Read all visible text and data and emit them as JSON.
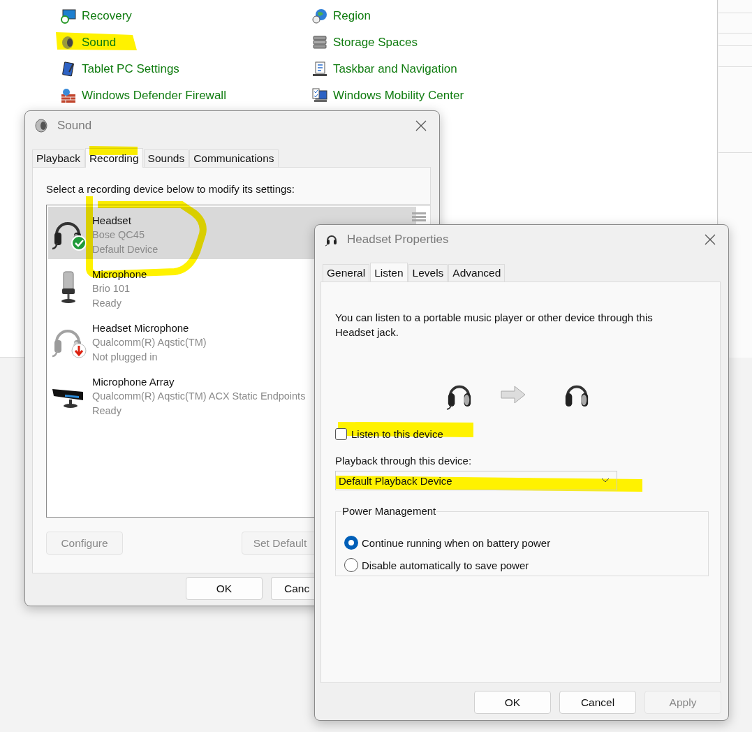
{
  "control_panel": {
    "columns": [
      [
        {
          "label": "Recovery"
        },
        {
          "label": "Sound"
        },
        {
          "label": "Tablet PC Settings"
        },
        {
          "label": "Windows Defender Firewall"
        }
      ],
      [
        {
          "label": "Region"
        },
        {
          "label": "Storage Spaces"
        },
        {
          "label": "Taskbar and Navigation"
        },
        {
          "label": "Windows Mobility Center"
        }
      ]
    ]
  },
  "sound_dialog": {
    "title": "Sound",
    "tabs": [
      {
        "label": "Playback",
        "selected": false
      },
      {
        "label": "Recording",
        "selected": true
      },
      {
        "label": "Sounds",
        "selected": false
      },
      {
        "label": "Communications",
        "selected": false
      }
    ],
    "instruction": "Select a recording device below to modify its settings:",
    "devices": [
      {
        "kind": "headset",
        "name": "Headset",
        "model": "Bose QC45",
        "status": "Default Device",
        "default": true,
        "unplugged": false,
        "selected": true
      },
      {
        "kind": "microphone",
        "name": "Microphone",
        "model": "Brio 101",
        "status": "Ready",
        "default": false,
        "unplugged": false,
        "selected": false
      },
      {
        "kind": "headset",
        "name": "Headset Microphone",
        "model": "Qualcomm(R) Aqstic(TM)",
        "status": "Not plugged in",
        "default": false,
        "unplugged": true,
        "selected": false
      },
      {
        "kind": "array",
        "name": "Microphone Array",
        "model": "Qualcomm(R) Aqstic(TM) ACX Static Endpoints",
        "status": "Ready",
        "default": false,
        "unplugged": false,
        "selected": false
      }
    ],
    "buttons": [
      {
        "label": "Configure",
        "disabled": true
      },
      {
        "label": "Set Default",
        "disabled": true
      }
    ],
    "footer_buttons": [
      {
        "label": "OK",
        "disabled": false
      },
      {
        "label": "Canc",
        "disabled": false
      }
    ]
  },
  "properties_dialog": {
    "title": "Headset Properties",
    "tabs": [
      {
        "label": "General",
        "selected": false
      },
      {
        "label": "Listen",
        "selected": true
      },
      {
        "label": "Levels",
        "selected": false
      },
      {
        "label": "Advanced",
        "selected": false
      }
    ],
    "description": "You can listen to a portable music player or other device through this Headset jack.",
    "listen_checkbox": {
      "label": "Listen to this device",
      "checked": false
    },
    "playback_label": "Playback through this device:",
    "playback_select": {
      "value": "Default Playback Device"
    },
    "power_management": {
      "title": "Power Management",
      "options": [
        {
          "label": "Continue running when on battery power",
          "selected": true
        },
        {
          "label": "Disable automatically to save power",
          "selected": false
        }
      ]
    },
    "buttons": [
      {
        "label": "OK",
        "disabled": false
      },
      {
        "label": "Cancel",
        "disabled": false
      },
      {
        "label": "Apply",
        "disabled": true
      }
    ]
  }
}
